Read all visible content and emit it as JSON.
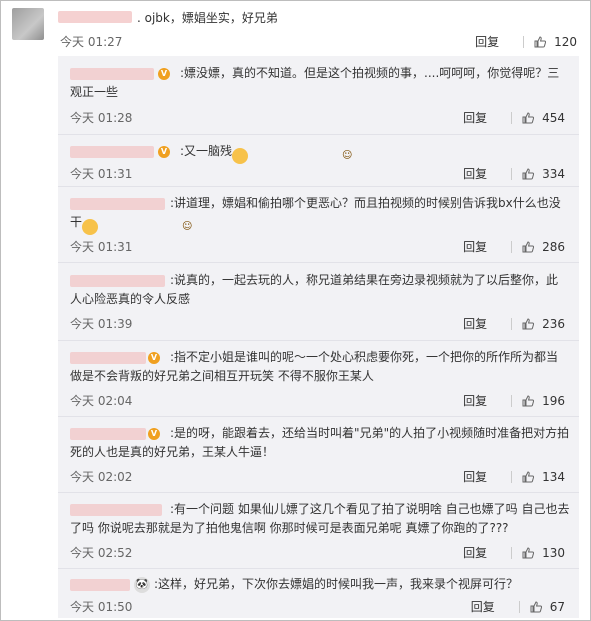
{
  "top": {
    "text": ". ojbk，嫖娼坐实，好兄弟",
    "time": "今天 01:27",
    "reply_label": "回复",
    "likes": "120"
  },
  "replies": [
    {
      "text": ":嫖没嫖，真的不知道。但是这个拍视频的事，....呵呵呵，你觉得呢？三观正一些",
      "time": "今天 01:28",
      "reply_label": "回复",
      "likes": "454"
    },
    {
      "text": ":又一脑残",
      "time": "今天 01:31",
      "reply_label": "回复",
      "likes": "334"
    },
    {
      "text": ":讲道理，嫖娼和偷拍哪个更恶心？而且拍视频的时候别告诉我bx什么也没干",
      "time": "今天 01:31",
      "reply_label": "回复",
      "likes": "286"
    },
    {
      "text": ":说真的，一起去玩的人，称兄道弟结果在旁边录视频就为了以后整你，此人心险恶真的令人反感",
      "time": "今天 01:39",
      "reply_label": "回复",
      "likes": "236"
    },
    {
      "text": ":指不定小姐是谁叫的呢～一个处心积虑要你死，一个把你的所作所为都当做是不会背叛的好兄弟之间相互开玩笑 不得不服你王某人",
      "time": "今天 02:04",
      "reply_label": "回复",
      "likes": "196"
    },
    {
      "text": ":是的呀，能跟着去，还给当时叫着\"兄弟\"的人拍了小视频随时准备把对方拍死的人也是真的好兄弟，王某人牛逼！",
      "time": "今天 02:02",
      "reply_label": "回复",
      "likes": "134"
    },
    {
      "text": ":有一个问题 如果仙儿嫖了这几个看见了拍了说明啥 自己也嫖了吗 自己也去了吗 你说呢去那就是为了拍他鬼信啊 你那时候可是表面兄弟呢 真嫖了你跑的了???",
      "time": "今天 02:52",
      "reply_label": "回复",
      "likes": "130"
    },
    {
      "text": ":这样，好兄弟，下次你去嫖娼的时候叫我一声，我来录个视屏可行？",
      "time": "今天 01:50",
      "reply_label": "回复",
      "likes": "67"
    }
  ]
}
